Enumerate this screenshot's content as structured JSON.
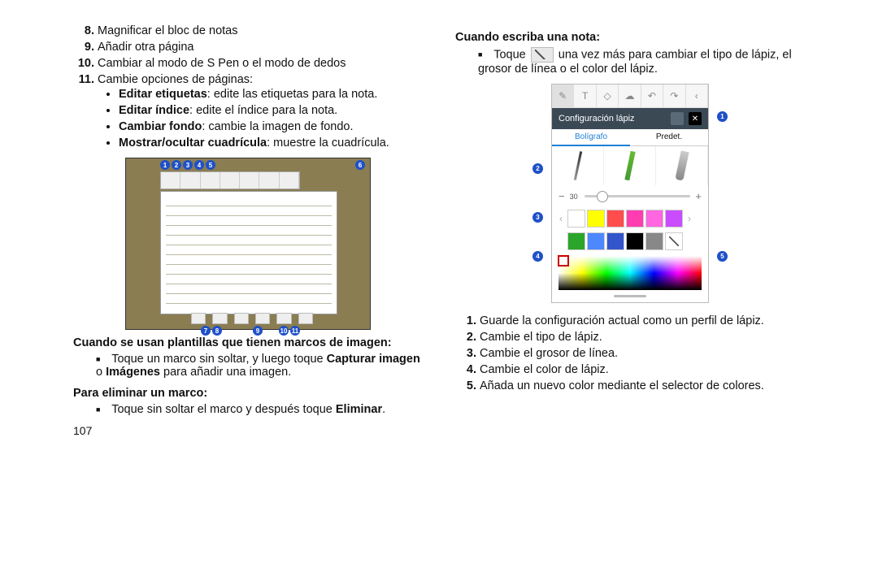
{
  "page_number": "107",
  "left": {
    "ol_start": 8,
    "items": [
      "Magnificar el bloc de notas",
      "Añadir otra página",
      "Cambiar al modo de S Pen o el modo de dedos",
      "Cambie opciones de páginas:"
    ],
    "sub": [
      {
        "b": "Editar etiquetas",
        "rest": ": edite las etiquetas para la nota."
      },
      {
        "b": "Editar índice",
        "rest": ": edite el índice para la nota."
      },
      {
        "b": "Cambiar fondo",
        "rest": ": cambie la imagen de fondo."
      },
      {
        "b": "Mostrar/ocultar cuadrícula",
        "rest": ": muestre la cuadrícula."
      }
    ],
    "h_templates": "Cuando se usan plantillas que tienen marcos de imagen:",
    "templates_pre": "Toque un marco sin soltar, y luego toque ",
    "templates_b1": "Capturar imagen",
    "templates_mid": " o ",
    "templates_b2": "Imágenes",
    "templates_post": " para añadir una imagen.",
    "h_remove": "Para eliminar un marco:",
    "remove_pre": "Toque sin soltar el marco y después toque ",
    "remove_b": "Eliminar",
    "remove_post": "."
  },
  "right": {
    "h_write": "Cuando escriba una nota:",
    "write_pre": "Toque ",
    "write_post": " una vez más para cambiar el tipo de lápiz, el grosor de línea o el color del lápiz.",
    "pen_header": "Configuración lápiz",
    "tab1": "Bolígrafo",
    "tab2": "Predet.",
    "slider_value": "30",
    "ol": [
      "Guarde la configuración actual como un perfil de lápiz.",
      "Cambie el tipo de lápiz.",
      "Cambie el grosor de línea.",
      "Cambie el color de lápiz.",
      "Añada un nuevo color mediante el selector de colores."
    ]
  },
  "callouts_tablet_top": [
    "1",
    "2",
    "3",
    "4",
    "5"
  ],
  "callouts_tablet_right": "6",
  "callouts_tablet_bottom": [
    "7",
    "8",
    "9",
    "10",
    "11"
  ],
  "callouts_phone": [
    "1",
    "2",
    "3",
    "4",
    "5"
  ],
  "swatches_row1": [
    "#ffffff",
    "#ffff00",
    "#ff4d4d",
    "#ff3db1",
    "#ff66e0",
    "#c94dff"
  ],
  "swatches_row2": [
    "#2aa62a",
    "#4d88ff",
    "#3355cc",
    "#000000",
    "#888888"
  ]
}
